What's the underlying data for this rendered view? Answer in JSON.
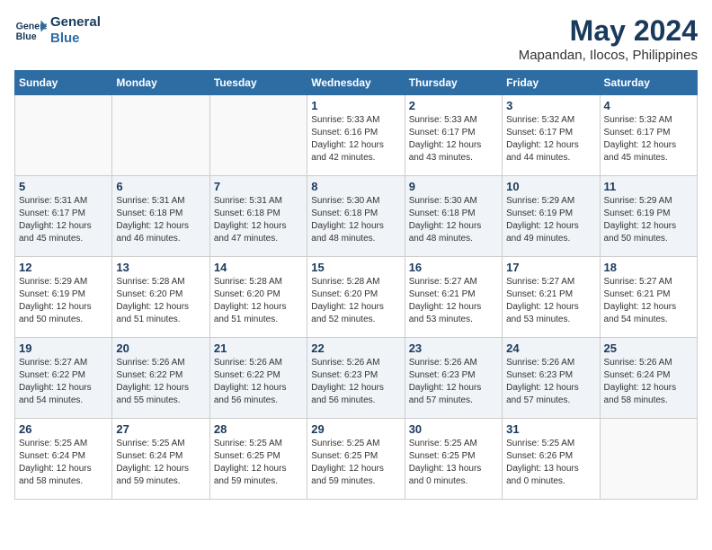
{
  "logo": {
    "name": "General",
    "name2": "Blue"
  },
  "title": {
    "month": "May 2024",
    "location": "Mapandan, Ilocos, Philippines"
  },
  "headers": [
    "Sunday",
    "Monday",
    "Tuesday",
    "Wednesday",
    "Thursday",
    "Friday",
    "Saturday"
  ],
  "weeks": [
    [
      {
        "day": "",
        "info": ""
      },
      {
        "day": "",
        "info": ""
      },
      {
        "day": "",
        "info": ""
      },
      {
        "day": "1",
        "info": "Sunrise: 5:33 AM\nSunset: 6:16 PM\nDaylight: 12 hours\nand 42 minutes."
      },
      {
        "day": "2",
        "info": "Sunrise: 5:33 AM\nSunset: 6:17 PM\nDaylight: 12 hours\nand 43 minutes."
      },
      {
        "day": "3",
        "info": "Sunrise: 5:32 AM\nSunset: 6:17 PM\nDaylight: 12 hours\nand 44 minutes."
      },
      {
        "day": "4",
        "info": "Sunrise: 5:32 AM\nSunset: 6:17 PM\nDaylight: 12 hours\nand 45 minutes."
      }
    ],
    [
      {
        "day": "5",
        "info": "Sunrise: 5:31 AM\nSunset: 6:17 PM\nDaylight: 12 hours\nand 45 minutes."
      },
      {
        "day": "6",
        "info": "Sunrise: 5:31 AM\nSunset: 6:18 PM\nDaylight: 12 hours\nand 46 minutes."
      },
      {
        "day": "7",
        "info": "Sunrise: 5:31 AM\nSunset: 6:18 PM\nDaylight: 12 hours\nand 47 minutes."
      },
      {
        "day": "8",
        "info": "Sunrise: 5:30 AM\nSunset: 6:18 PM\nDaylight: 12 hours\nand 48 minutes."
      },
      {
        "day": "9",
        "info": "Sunrise: 5:30 AM\nSunset: 6:18 PM\nDaylight: 12 hours\nand 48 minutes."
      },
      {
        "day": "10",
        "info": "Sunrise: 5:29 AM\nSunset: 6:19 PM\nDaylight: 12 hours\nand 49 minutes."
      },
      {
        "day": "11",
        "info": "Sunrise: 5:29 AM\nSunset: 6:19 PM\nDaylight: 12 hours\nand 50 minutes."
      }
    ],
    [
      {
        "day": "12",
        "info": "Sunrise: 5:29 AM\nSunset: 6:19 PM\nDaylight: 12 hours\nand 50 minutes."
      },
      {
        "day": "13",
        "info": "Sunrise: 5:28 AM\nSunset: 6:20 PM\nDaylight: 12 hours\nand 51 minutes."
      },
      {
        "day": "14",
        "info": "Sunrise: 5:28 AM\nSunset: 6:20 PM\nDaylight: 12 hours\nand 51 minutes."
      },
      {
        "day": "15",
        "info": "Sunrise: 5:28 AM\nSunset: 6:20 PM\nDaylight: 12 hours\nand 52 minutes."
      },
      {
        "day": "16",
        "info": "Sunrise: 5:27 AM\nSunset: 6:21 PM\nDaylight: 12 hours\nand 53 minutes."
      },
      {
        "day": "17",
        "info": "Sunrise: 5:27 AM\nSunset: 6:21 PM\nDaylight: 12 hours\nand 53 minutes."
      },
      {
        "day": "18",
        "info": "Sunrise: 5:27 AM\nSunset: 6:21 PM\nDaylight: 12 hours\nand 54 minutes."
      }
    ],
    [
      {
        "day": "19",
        "info": "Sunrise: 5:27 AM\nSunset: 6:22 PM\nDaylight: 12 hours\nand 54 minutes."
      },
      {
        "day": "20",
        "info": "Sunrise: 5:26 AM\nSunset: 6:22 PM\nDaylight: 12 hours\nand 55 minutes."
      },
      {
        "day": "21",
        "info": "Sunrise: 5:26 AM\nSunset: 6:22 PM\nDaylight: 12 hours\nand 56 minutes."
      },
      {
        "day": "22",
        "info": "Sunrise: 5:26 AM\nSunset: 6:23 PM\nDaylight: 12 hours\nand 56 minutes."
      },
      {
        "day": "23",
        "info": "Sunrise: 5:26 AM\nSunset: 6:23 PM\nDaylight: 12 hours\nand 57 minutes."
      },
      {
        "day": "24",
        "info": "Sunrise: 5:26 AM\nSunset: 6:23 PM\nDaylight: 12 hours\nand 57 minutes."
      },
      {
        "day": "25",
        "info": "Sunrise: 5:26 AM\nSunset: 6:24 PM\nDaylight: 12 hours\nand 58 minutes."
      }
    ],
    [
      {
        "day": "26",
        "info": "Sunrise: 5:25 AM\nSunset: 6:24 PM\nDaylight: 12 hours\nand 58 minutes."
      },
      {
        "day": "27",
        "info": "Sunrise: 5:25 AM\nSunset: 6:24 PM\nDaylight: 12 hours\nand 59 minutes."
      },
      {
        "day": "28",
        "info": "Sunrise: 5:25 AM\nSunset: 6:25 PM\nDaylight: 12 hours\nand 59 minutes."
      },
      {
        "day": "29",
        "info": "Sunrise: 5:25 AM\nSunset: 6:25 PM\nDaylight: 12 hours\nand 59 minutes."
      },
      {
        "day": "30",
        "info": "Sunrise: 5:25 AM\nSunset: 6:25 PM\nDaylight: 13 hours\nand 0 minutes."
      },
      {
        "day": "31",
        "info": "Sunrise: 5:25 AM\nSunset: 6:26 PM\nDaylight: 13 hours\nand 0 minutes."
      },
      {
        "day": "",
        "info": ""
      }
    ]
  ]
}
